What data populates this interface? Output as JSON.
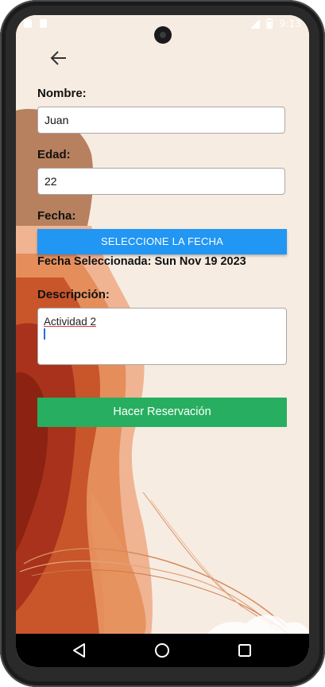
{
  "status_bar": {
    "time": "9:13"
  },
  "toolbar": {
    "back_icon": "arrow-back-icon"
  },
  "form": {
    "name_label": "Nombre:",
    "name_value": "Juan",
    "age_label": "Edad:",
    "age_value": "22",
    "date_label": "Fecha:",
    "date_button_label": "SELECCIONE LA FECHA",
    "selected_date_text": "Fecha Seleccionada: Sun Nov 19 2023",
    "description_label": "Descripción:",
    "description_value": "Actividad 2",
    "submit_label": "Hacer Reservación"
  },
  "colors": {
    "background": "#f7ece2",
    "date_button": "#2196f3",
    "submit_button": "#27ae60"
  },
  "nav": {
    "back_icon": "triangle-back-icon",
    "home_icon": "circle-home-icon",
    "recents_icon": "square-recents-icon"
  }
}
